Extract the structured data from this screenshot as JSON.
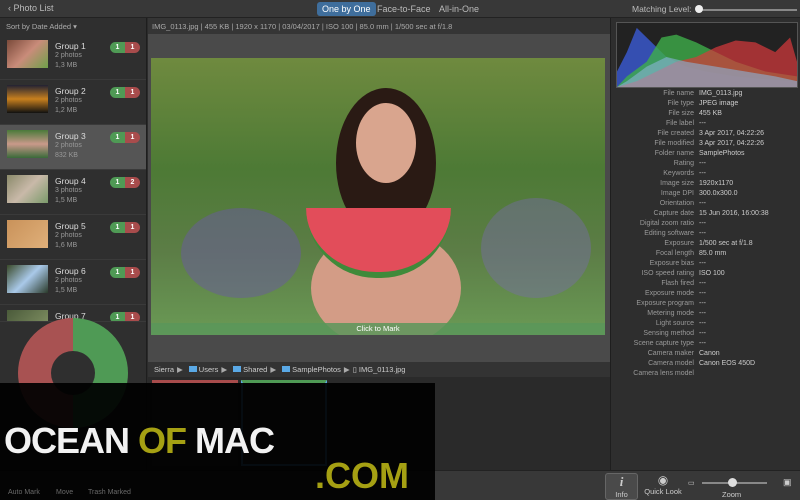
{
  "top": {
    "back": "Photo List",
    "modes": [
      "One by One",
      "Face-to-Face",
      "All-in-One"
    ],
    "matching_label": "Matching Level:",
    "matching_level": 0
  },
  "sidebar": {
    "sort": "Sort by Date Added ▾",
    "groups": [
      {
        "name": "Group 1",
        "photos": "2 photos",
        "size": "1,3 MB",
        "keep": "1",
        "mark": "1"
      },
      {
        "name": "Group 2",
        "photos": "2 photos",
        "size": "1,2 MB",
        "keep": "1",
        "mark": "1"
      },
      {
        "name": "Group 3",
        "photos": "2 photos",
        "size": "832 KB",
        "keep": "1",
        "mark": "1"
      },
      {
        "name": "Group 4",
        "photos": "3 photos",
        "size": "1,5 MB",
        "keep": "1",
        "mark": "2"
      },
      {
        "name": "Group 5",
        "photos": "2 photos",
        "size": "1,6 MB",
        "keep": "1",
        "mark": "1"
      },
      {
        "name": "Group 6",
        "photos": "2 photos",
        "size": "1,5 MB",
        "keep": "1",
        "mark": "1"
      },
      {
        "name": "Group 7",
        "photos": "",
        "size": "",
        "keep": "1",
        "mark": "1"
      }
    ],
    "selected": 2,
    "actions": [
      "Auto Mark",
      "Move",
      "Trash Marked"
    ]
  },
  "viewer": {
    "infobar": "IMG_0113.jpg  |  455 KB  |  1920 x 1170  |  03/04/2017  |  ISO 100  |  85.0 mm  |  1/500 sec at f/1.8",
    "click_to_mark": "Click to Mark",
    "path": [
      "Sierra",
      "Users",
      "Shared",
      "SamplePhotos",
      "IMG_0113.jpg"
    ]
  },
  "info": [
    [
      "File name",
      "IMG_0113.jpg"
    ],
    [
      "File type",
      "JPEG image"
    ],
    [
      "File size",
      "455 KB"
    ],
    [
      "File label",
      "---"
    ],
    [
      "File created",
      "3 Apr 2017, 04:22:26"
    ],
    [
      "File modified",
      "3 Apr 2017, 04:22:26"
    ],
    [
      "Folder name",
      "SamplePhotos"
    ],
    [
      "Rating",
      "---"
    ],
    [
      "Keywords",
      "---"
    ],
    [
      "Image size",
      "1920x1170"
    ],
    [
      "Image DPI",
      "300.0x300.0"
    ],
    [
      "Orientation",
      "---"
    ],
    [
      "Capture date",
      "15 Jun 2016, 16:00:38"
    ],
    [
      "Digital zoom ratio",
      "---"
    ],
    [
      "Editing software",
      "---"
    ],
    [
      "Exposure",
      "1/500 sec at f/1.8"
    ],
    [
      "Focal length",
      "85.0 mm"
    ],
    [
      "Exposure bias",
      "---"
    ],
    [
      "ISO speed rating",
      "ISO 100"
    ],
    [
      "Flash fired",
      "---"
    ],
    [
      "Exposure mode",
      "---"
    ],
    [
      "Exposure program",
      "---"
    ],
    [
      "Metering mode",
      "---"
    ],
    [
      "Light source",
      "---"
    ],
    [
      "Sensing method",
      "---"
    ],
    [
      "Scene capture type",
      "---"
    ],
    [
      "Camera maker",
      "Canon"
    ],
    [
      "Camera model",
      "Canon EOS 450D"
    ],
    [
      "Camera lens model",
      ""
    ]
  ],
  "bottom": {
    "info": "Info",
    "quicklook": "Quick Look",
    "zoom": "Zoom"
  },
  "watermark": {
    "text1": "OCEAN",
    "text2": "OF",
    "text3": "MAC",
    "text4": ".COM"
  },
  "colors": {
    "accent": "#3f6e9c",
    "keep": "#4f9a55",
    "mark": "#a84c4c",
    "watermark": "#a5a013"
  }
}
